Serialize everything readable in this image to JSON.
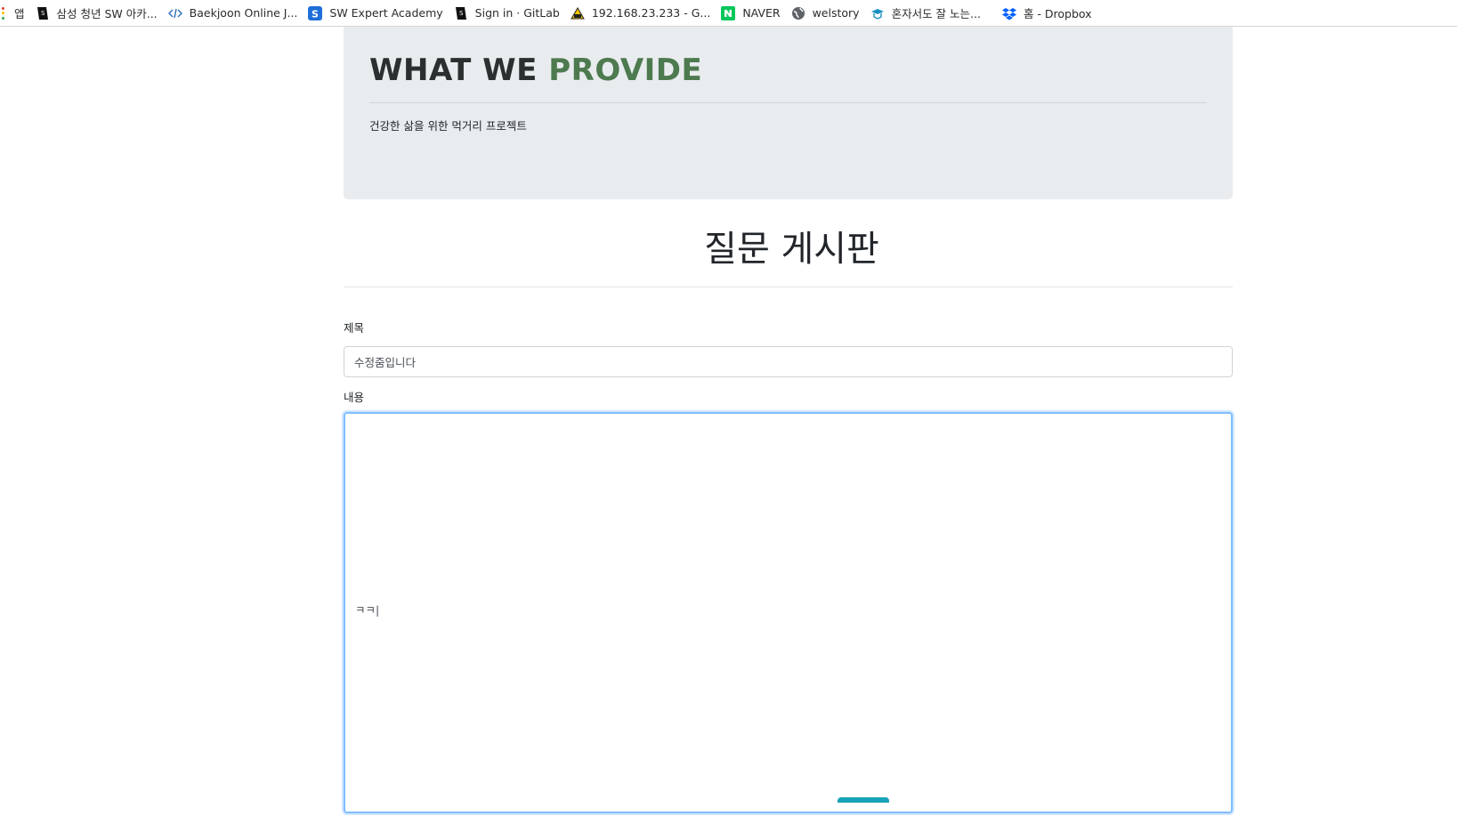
{
  "bookmarks": [
    {
      "label": "앱",
      "icon": "apps-grid-icon"
    },
    {
      "label": "삼성 청년 SW 아카...",
      "icon": "ssafy-icon"
    },
    {
      "label": "Baekjoon Online J...",
      "icon": "code-brackets-icon"
    },
    {
      "label": "SW Expert Academy",
      "icon": "swea-icon"
    },
    {
      "label": "Sign in · GitLab",
      "icon": "ssafy-icon"
    },
    {
      "label": "192.168.23.233 - G...",
      "icon": "server-icon"
    },
    {
      "label": "NAVER",
      "icon": "naver-icon"
    },
    {
      "label": "welstory",
      "icon": "globe-icon"
    },
    {
      "label": "혼자서도 잘 노는...",
      "icon": "graduation-cap-icon"
    },
    {
      "label": "홈 - Dropbox",
      "icon": "dropbox-icon"
    }
  ],
  "jumbotron": {
    "title_plain": "WHAT WE ",
    "title_accent": "PROVIDE",
    "subtitle": "건강한 삶을 위한 먹거리 프로젝트"
  },
  "board": {
    "title": "질문 게시판",
    "title_label": "제목",
    "title_value": "수정줌입니다",
    "content_label": "내용",
    "content_value": "ㅋㅋ|"
  },
  "colors": {
    "accent_green": "#4d7a4f",
    "jumbotron_bg": "#e9ecef",
    "focus_border": "#80bdff",
    "submit_teal": "#17a2b8"
  }
}
